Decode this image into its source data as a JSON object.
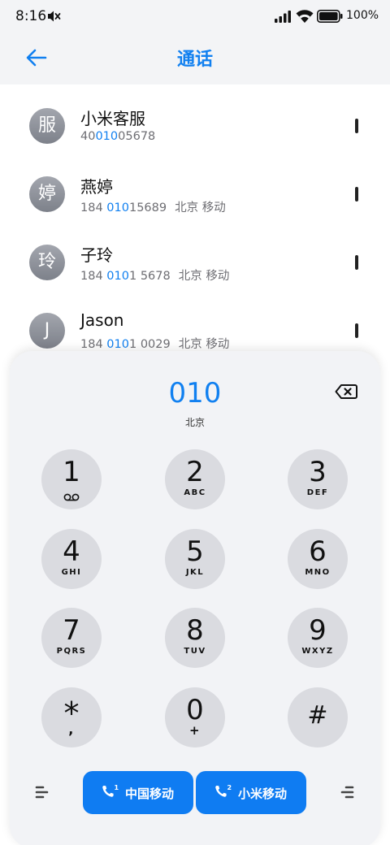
{
  "status": {
    "time": "8:16",
    "battery": "100%"
  },
  "header": {
    "title": "通话"
  },
  "contacts": [
    {
      "avatar": "服",
      "name": "小米客服",
      "num_pre": "40",
      "num_hl": "010",
      "num_post": "05678",
      "location": ""
    },
    {
      "avatar": "婷",
      "name": "燕婷",
      "num_pre": "184 ",
      "num_hl": "010",
      "num_post": "15689",
      "location": "北京 移动"
    },
    {
      "avatar": "玲",
      "name": "子玲",
      "num_pre": "184 ",
      "num_hl": "010",
      "num_post": "1 5678",
      "location": "北京 移动"
    },
    {
      "avatar": "J",
      "name": "Jason",
      "num_pre": "184 ",
      "num_hl": "010",
      "num_post": "1 0029",
      "location": "北京 移动"
    }
  ],
  "dialer": {
    "number": "010",
    "location": "北京",
    "keys": [
      {
        "digit": "1",
        "sub": ""
      },
      {
        "digit": "2",
        "sub": "ABC"
      },
      {
        "digit": "3",
        "sub": "DEF"
      },
      {
        "digit": "4",
        "sub": "GHI"
      },
      {
        "digit": "5",
        "sub": "JKL"
      },
      {
        "digit": "6",
        "sub": "MNO"
      },
      {
        "digit": "7",
        "sub": "PQRS"
      },
      {
        "digit": "8",
        "sub": "TUV"
      },
      {
        "digit": "9",
        "sub": "WXYZ"
      },
      {
        "digit": "*",
        "sub": ","
      },
      {
        "digit": "0",
        "sub": "+"
      },
      {
        "digit": "#",
        "sub": ""
      }
    ],
    "sim1_label": "中国移动",
    "sim2_label": "小米移动",
    "sim1_num": "1",
    "sim2_num": "2"
  },
  "colors": {
    "accent": "#1180f0",
    "call_button": "#0f7cf2",
    "key_bg": "#dadbe0",
    "panel_bg": "#f2f3f6"
  }
}
